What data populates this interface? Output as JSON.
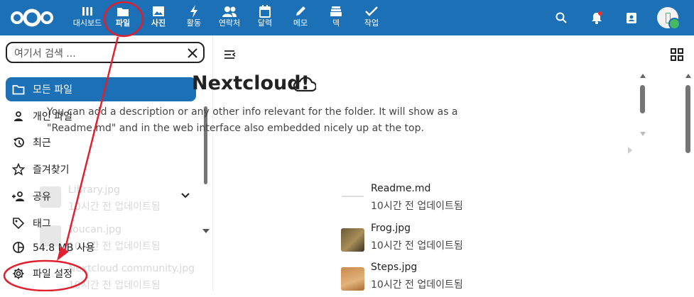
{
  "header": {
    "apps": [
      {
        "label": "대시보드",
        "icon": "dashboard-icon"
      },
      {
        "label": "파일",
        "icon": "folder-icon",
        "active": true
      },
      {
        "label": "사진",
        "icon": "photos-icon",
        "active": true
      },
      {
        "label": "활동",
        "icon": "activity-icon"
      },
      {
        "label": "연락처",
        "icon": "contacts-icon"
      },
      {
        "label": "달력",
        "icon": "calendar-icon"
      },
      {
        "label": "메모",
        "icon": "notes-icon"
      },
      {
        "label": "덱",
        "icon": "deck-icon"
      },
      {
        "label": "작업",
        "icon": "tasks-icon"
      }
    ],
    "right_icons": [
      "search-icon",
      "notifications-icon",
      "contacts-menu-icon"
    ]
  },
  "sidebar": {
    "search": {
      "value": "",
      "placeholder": "여기서 검색 ..."
    },
    "items": [
      {
        "label": "모든 파일",
        "icon": "folder-icon",
        "active": true
      },
      {
        "label": "개인 파일",
        "icon": "person-icon"
      },
      {
        "label": "최근",
        "icon": "history-icon"
      },
      {
        "label": "즐겨찾기",
        "icon": "star-icon"
      },
      {
        "label": "공유",
        "icon": "share-icon"
      },
      {
        "label": "태그",
        "icon": "tag-icon"
      },
      {
        "label": "54.8 MB 사용",
        "icon": "quota-icon"
      },
      {
        "label": "파일 설정",
        "icon": "gear-icon"
      }
    ]
  },
  "main": {
    "title": "Nextcloud!",
    "description": "You can add a description or any other info relevant for the folder. It will show as a \"Readme.md\" and in the web interface also embedded nicely up at the top.",
    "files": [
      {
        "name": "Readme.md",
        "time": "10시간 전 업데이트됨"
      },
      {
        "name": "Frog.jpg",
        "time": "10시간 전 업데이트됨"
      },
      {
        "name": "Steps.jpg",
        "time": "10시간 전 업데이트됨"
      }
    ],
    "ghost_files": [
      {
        "name": "Library.jpg",
        "time": "10시간 전 업데이트됨"
      },
      {
        "name": "Toucan.jpg",
        "time": "10시간 전 업데이트됨"
      },
      {
        "name": "Nextcloud community.jpg",
        "time": "10시간 전 업데이트됨"
      }
    ]
  },
  "colors": {
    "brand": "#1b70b6",
    "annotation": "#e0202e"
  }
}
